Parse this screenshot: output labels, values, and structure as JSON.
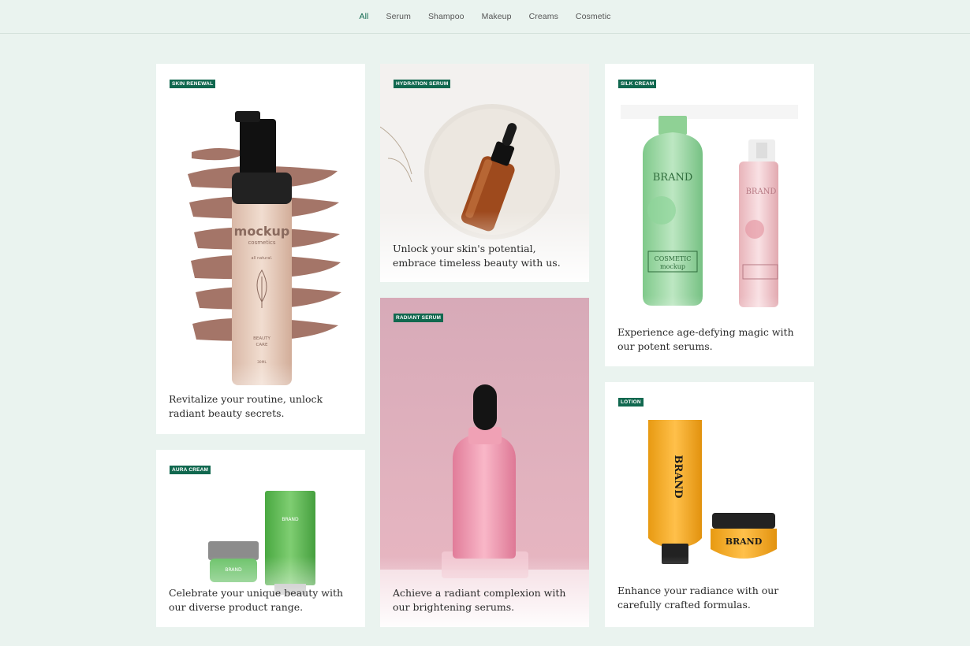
{
  "nav": {
    "items": [
      "All",
      "Serum",
      "Shampoo",
      "Makeup",
      "Creams",
      "Cosmetic"
    ],
    "active": "All"
  },
  "cards": {
    "skin_renewal": {
      "badge": "SKIN RENEWAL",
      "caption": "Revitalize your routine, unlock radiant beauty secrets.",
      "label_brand": "mockup",
      "label_sub": "cosmetics",
      "label_natural": "all natural.",
      "label_care1": "BEAUTY",
      "label_care2": "CARE",
      "label_vol": "30ML"
    },
    "hydration_serum": {
      "badge": "HYDRATION SERUM",
      "caption": "Unlock your skin's potential, embrace timeless beauty with us."
    },
    "silk_cream": {
      "badge": "SILK CREAM",
      "caption": "Experience age-defying magic with our potent serums.",
      "label_brand": "BRAND",
      "label_cos": "COSMETIC",
      "label_mock": "mockup"
    },
    "radiant_serum": {
      "badge": "RADIANT SERUM",
      "caption": "Achieve a radiant complexion with our brightening serums."
    },
    "aura_cream": {
      "badge": "AURA CREAM",
      "caption": "Celebrate your unique beauty with our diverse product range.",
      "label_brand": "BRAND"
    },
    "lotion": {
      "badge": "LOTION",
      "caption": "Enhance your radiance with our carefully crafted formulas.",
      "label_brand": "BRAND"
    }
  },
  "colors": {
    "accent": "#11684f",
    "background": "#eaf3ef"
  }
}
